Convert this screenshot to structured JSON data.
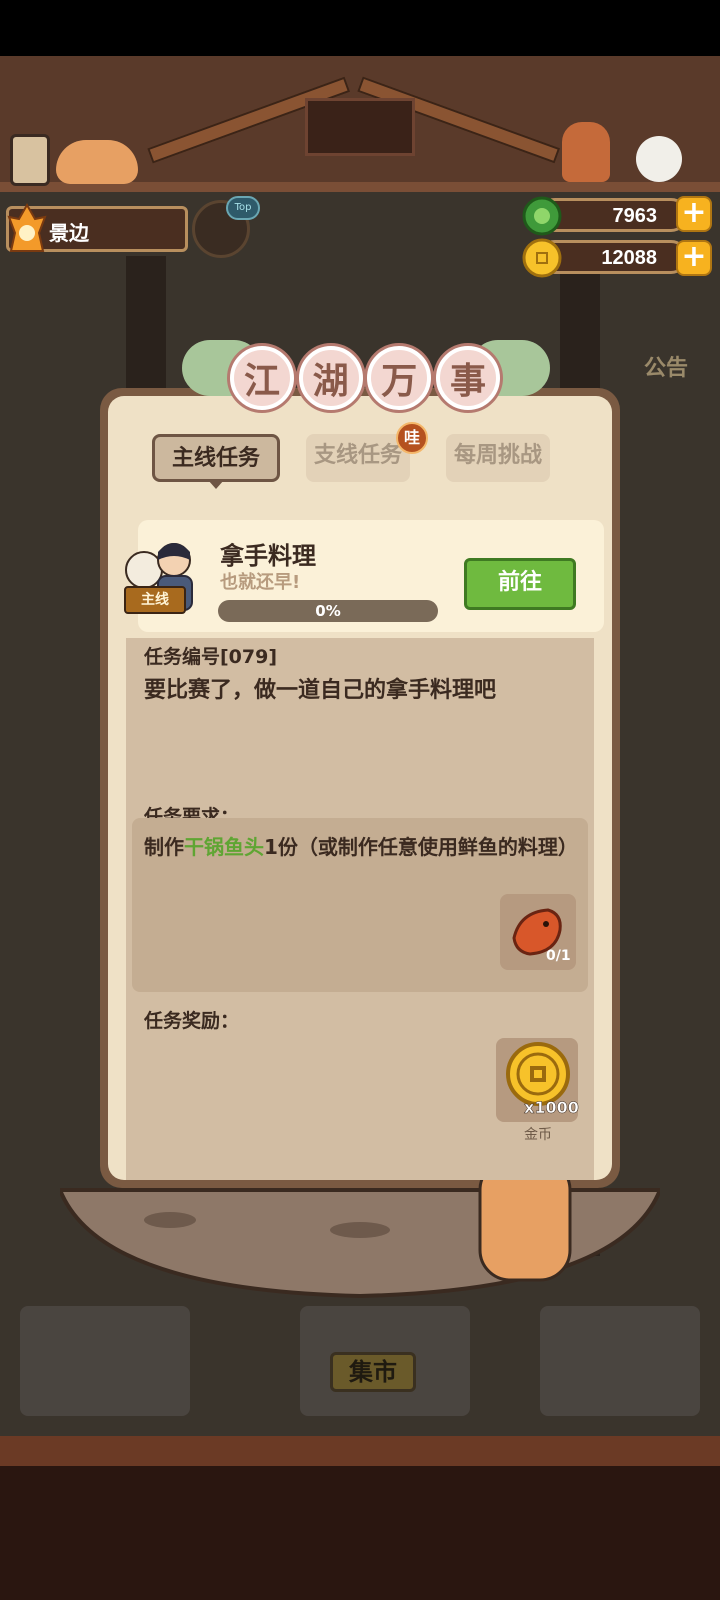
{
  "player": {
    "name": "景边",
    "avatar_badge": "Top"
  },
  "resources": {
    "jade": "7963",
    "coins": "12088",
    "plus": "+"
  },
  "background": {
    "market_sign": "集市",
    "right_notice": "公告"
  },
  "panel": {
    "title_chars": [
      "江",
      "湖",
      "万",
      "事"
    ],
    "tabs": [
      {
        "label": "主线任务",
        "active": true
      },
      {
        "label": "支线任务",
        "active": false
      },
      {
        "label": "每周挑战",
        "active": false
      }
    ],
    "tab_badge": "哇"
  },
  "quest": {
    "tag": "主线",
    "name": "拿手料理",
    "subtitle": "也就还早!",
    "progress_text": "0%",
    "progress_value": 0,
    "goto_label": "前往",
    "number": "任务编号[079]",
    "description": "要比赛了，做一道自己的拿手料理吧",
    "requirement_title": "任务要求：",
    "requirement_prefix": "制作",
    "requirement_highlight": "干锅鱼头",
    "requirement_suffix": "1份（或制作任意使用鲜鱼的料理）",
    "item_count": "0/1",
    "reward_title": "任务奖励：",
    "reward_qty": "x1000",
    "reward_label": "金币"
  },
  "colors": {
    "panel_bg": "#efe1c6",
    "accent_green": "#6fba3f",
    "highlight_green": "#5fa533",
    "coin_gold": "#f7b21f"
  }
}
